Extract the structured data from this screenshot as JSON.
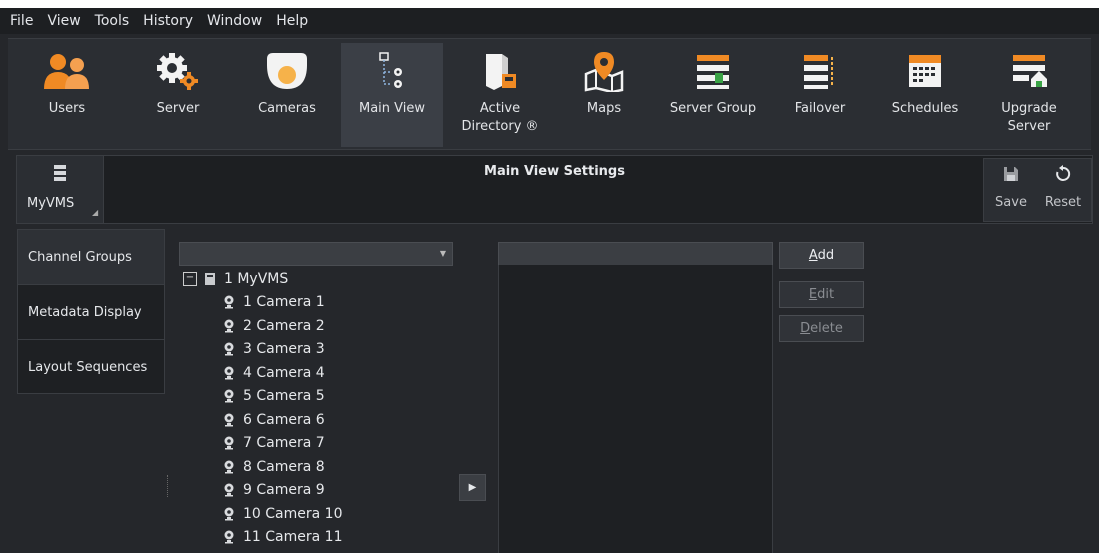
{
  "menu": [
    "File",
    "View",
    "Tools",
    "History",
    "Window",
    "Help"
  ],
  "toolbar": [
    {
      "label": "Users",
      "icon": "users-icon"
    },
    {
      "label": "Server",
      "icon": "server-gear-icon"
    },
    {
      "label": "Cameras",
      "icon": "dome-camera-icon"
    },
    {
      "label": "Main View",
      "icon": "main-view-icon",
      "active": true
    },
    {
      "label": "Active\nDirectory ®",
      "icon": "active-directory-icon"
    },
    {
      "label": "Maps",
      "icon": "map-pin-icon"
    },
    {
      "label": "Server Group",
      "icon": "server-group-icon"
    },
    {
      "label": "Failover",
      "icon": "failover-icon"
    },
    {
      "label": "Schedules",
      "icon": "calendar-icon"
    },
    {
      "label": "Upgrade\nServer",
      "icon": "upgrade-server-icon"
    }
  ],
  "settings": {
    "server_label": "MyVMS",
    "title": "Main View Settings",
    "save_label": "Save",
    "reset_label": "Reset"
  },
  "left_tabs": [
    "Channel Groups",
    "Metadata Display",
    "Layout Sequences"
  ],
  "tree": {
    "root": "1 MyVMS",
    "cameras": [
      "1 Camera 1",
      "2 Camera 2",
      "3 Camera 3",
      "4 Camera 4",
      "5 Camera 5",
      "6 Camera 6",
      "7 Camera 7",
      "8 Camera 8",
      "9 Camera 9",
      "10 Camera 10",
      "11 Camera 11"
    ]
  },
  "actions": {
    "add": {
      "key": "A",
      "rest": "dd"
    },
    "edit": {
      "key": "E",
      "rest": "dit"
    },
    "delete": {
      "key": "D",
      "rest": "elete"
    }
  },
  "colors": {
    "accent_orange": "#f08a24",
    "background": "#25272b"
  }
}
